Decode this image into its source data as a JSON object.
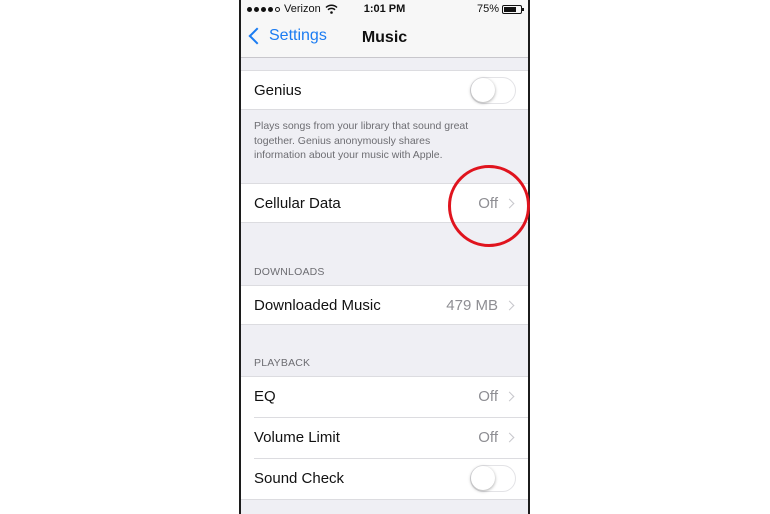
{
  "status_bar": {
    "carrier": "Verizon",
    "time": "1:01 PM",
    "battery": "75%",
    "battery_level": 0.75
  },
  "nav": {
    "back_label": "Settings",
    "title": "Music"
  },
  "genius": {
    "label": "Genius",
    "enabled": false,
    "note_lines": [
      "Plays songs from your library that sound great",
      "together. Genius anonymously shares",
      "information about your music with Apple."
    ]
  },
  "cellular": {
    "label": "Cellular Data",
    "value": "Off"
  },
  "downloads": {
    "header": "DOWNLOADS",
    "downloaded_label": "Downloaded Music",
    "downloaded_value": "479 MB"
  },
  "playback": {
    "header": "PLAYBACK",
    "eq_label": "EQ",
    "eq_value": "Off",
    "volume_label": "Volume Limit",
    "volume_value": "Off",
    "sound_check_label": "Sound Check",
    "sound_check_enabled": false
  },
  "colors": {
    "accent": "#1b7cf2",
    "highlight_circle": "#e0141e",
    "background": "#efeff4"
  }
}
